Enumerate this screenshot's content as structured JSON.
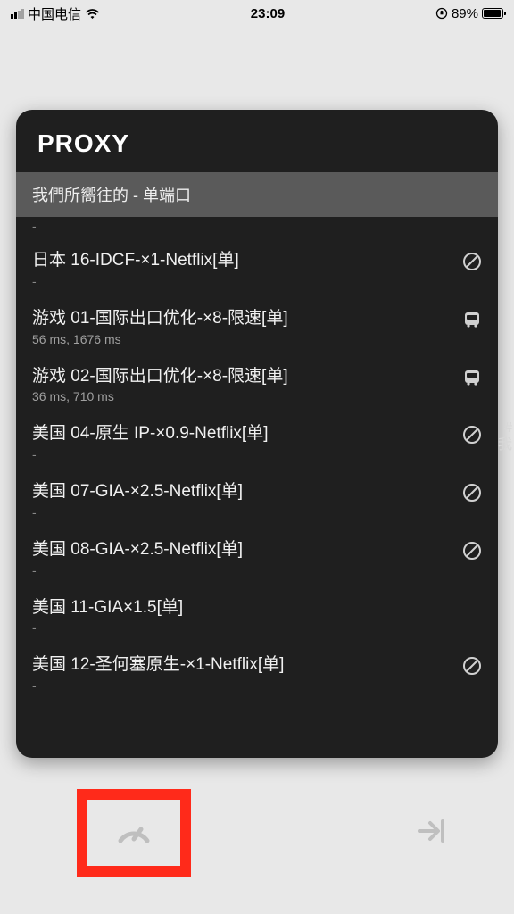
{
  "status": {
    "carrier": "中国电信",
    "time": "23:09",
    "battery": "89%"
  },
  "card": {
    "title": "PROXY",
    "group": "我們所嚮往的 - 单端口",
    "side_hash": "#",
    "side_char": "我",
    "rows": [
      {
        "title": "日本 16-IDCF-×1-Netflix[单]",
        "sub": "-",
        "icon": "block"
      },
      {
        "title": "游戏 01-国际出口优化-×8-限速[单]",
        "sub": "56 ms,     1676 ms",
        "icon": "bus"
      },
      {
        "title": "游戏 02-国际出口优化-×8-限速[单]",
        "sub": "36 ms,     710 ms",
        "icon": "bus"
      },
      {
        "title": "美国 04-原生 IP-×0.9-Netflix[单]",
        "sub": "-",
        "icon": "block"
      },
      {
        "title": "美国 07-GIA-×2.5-Netflix[单]",
        "sub": "-",
        "icon": "block"
      },
      {
        "title": "美国 08-GIA-×2.5-Netflix[单]",
        "sub": "-",
        "icon": "block"
      },
      {
        "title": "美国 11-GIA×1.5[单]",
        "sub": "-",
        "icon": "none"
      },
      {
        "title": "美国 12-圣何塞原生-×1-Netflix[单]",
        "sub": "-",
        "icon": "block"
      }
    ]
  }
}
